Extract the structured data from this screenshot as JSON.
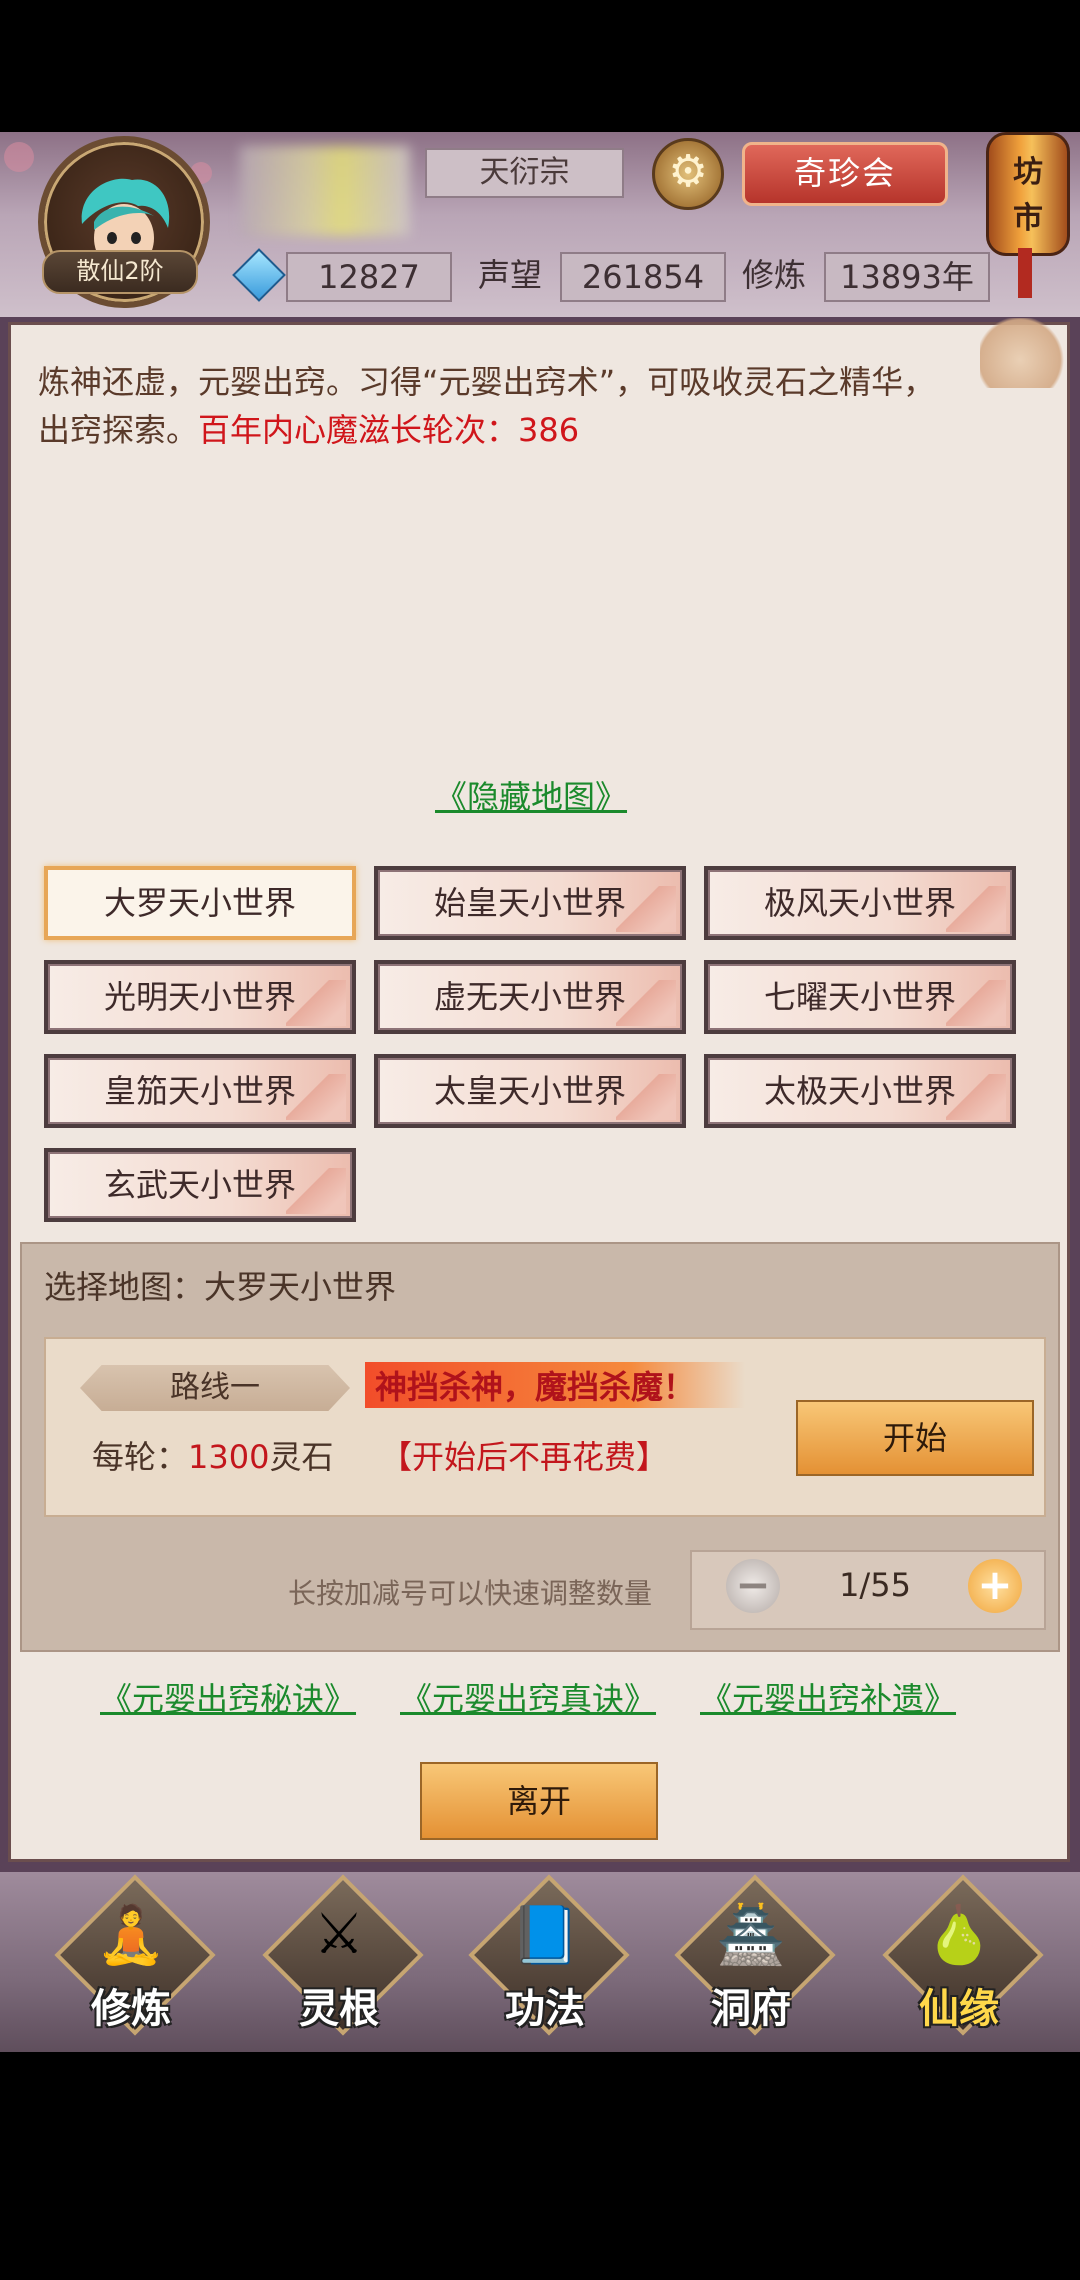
{
  "header": {
    "rank": "散仙2阶",
    "sect": "天衍宗",
    "treasure_label": "奇珍会",
    "market_label_top": "坊",
    "market_label_bottom": "市",
    "spirit_stones": "12827",
    "reputation_label": "声望",
    "reputation": "261854",
    "cultivation_label": "修炼",
    "cultivation_years": "13893年"
  },
  "main": {
    "intro_text": "炼神还虚，元婴出窍。习得“元婴出窍术”，可吸收灵石之精华，出窍探索。",
    "intro_red": "百年内心魔滋长轮次：386",
    "hidden_map_link": "《隐藏地图》",
    "maps": [
      "大罗天小世界",
      "始皇天小世界",
      "极风天小世界",
      "光明天小世界",
      "虚无天小世界",
      "七曜天小世界",
      "皇笳天小世界",
      "太皇天小世界",
      "太极天小世界",
      "玄武天小世界"
    ],
    "selected_map_label": "选择地图：大罗天小世界",
    "route_label": "路线一",
    "slogan": "神挡杀神，魔挡杀魔！",
    "cost_prefix": "每轮：",
    "cost_value": "1300",
    "cost_unit": "灵石",
    "cost_note": "【开始后不再花费】",
    "start_button": "开始",
    "hint": "长按加减号可以快速调整数量",
    "stepper_value": "1/55",
    "links": [
      "《元婴出窍秘诀》",
      "《元婴出窍真诀》",
      "《元婴出窍补遗》"
    ],
    "leave_button": "离开"
  },
  "bottom_nav": {
    "items": [
      {
        "label": "修炼",
        "icon": "monk-icon"
      },
      {
        "label": "灵根",
        "icon": "sword-icon"
      },
      {
        "label": "功法",
        "icon": "book-icon"
      },
      {
        "label": "洞府",
        "icon": "pagoda-icon"
      },
      {
        "label": "仙缘",
        "icon": "gourd-icon"
      }
    ]
  },
  "colors": {
    "accent_red": "#d0161b",
    "link_green": "#1b8a2c",
    "button_orange": "#e49134"
  }
}
